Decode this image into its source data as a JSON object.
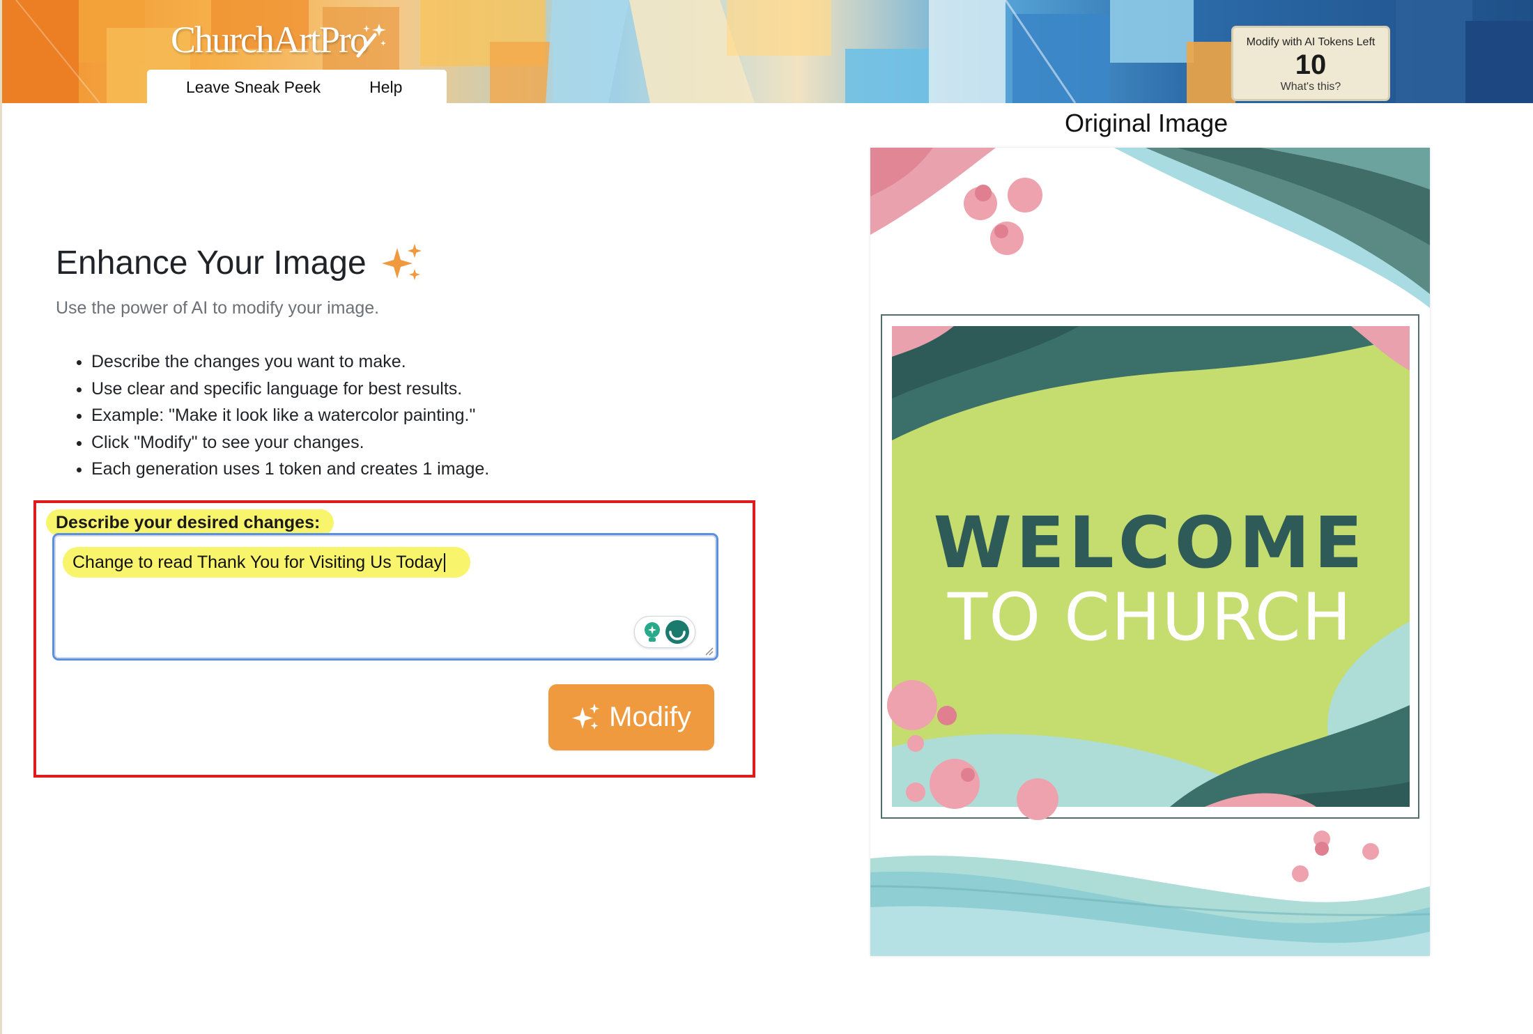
{
  "header": {
    "logo_text": "ChurchArtPro",
    "nav": [
      {
        "label": "Leave Sneak Peek"
      },
      {
        "label": "Help"
      }
    ],
    "tokens": {
      "label": "Modify with AI Tokens Left",
      "count": "10",
      "help_link": "What's this?"
    }
  },
  "main": {
    "title": "Enhance Your Image",
    "subtitle": "Use the power of AI to modify your image.",
    "instructions": [
      "Describe the changes you want to make.",
      "Use clear and specific language for best results.",
      "Example: \"Make it look like a watercolor painting.\"",
      "Click \"Modify\" to see your changes.",
      "Each generation uses 1 token and creates 1 image."
    ],
    "form": {
      "label": "Describe your desired changes:",
      "value": "Change to read Thank You for Visiting Us Today",
      "button_label": "Modify"
    }
  },
  "preview": {
    "title": "Original Image",
    "image_text_line1": "WELCOME",
    "image_text_line2": "TO CHURCH"
  },
  "colors": {
    "accent_orange": "#ef9a3f",
    "highlight_yellow": "#f8f56c",
    "annotation_red": "#e01b1b",
    "image_teal": "#2e5b57",
    "image_green": "#c5dc6f"
  },
  "icons": [
    "magic-wand-icon",
    "sparkles-icon",
    "lightbulb-icon",
    "grammar-assistant-icon",
    "resize-grip-icon"
  ]
}
